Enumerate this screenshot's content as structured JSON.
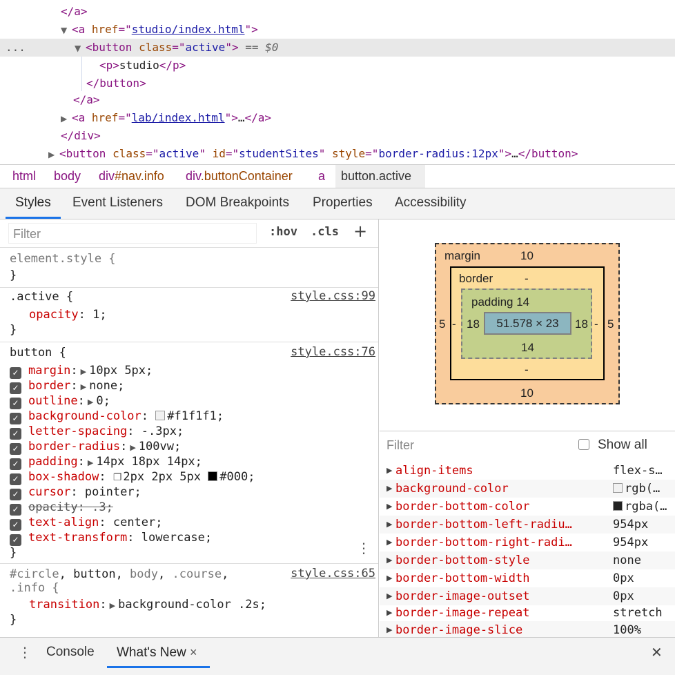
{
  "dom_tree": {
    "lines": [
      {
        "close_a": "</a>"
      },
      {
        "open": "<a",
        "attr": "href",
        "val": "studio/index.html",
        "end": ">"
      },
      {
        "indicator": "...",
        "open": "<button",
        "attr": "class",
        "val": "active",
        "end": ">",
        "eq": " == $0"
      },
      {
        "text": "studio"
      },
      {
        "close_button": "</button>"
      },
      {
        "close_a": "</a>"
      },
      {
        "open": "<a",
        "attr": "href",
        "val": "lab/index.html",
        "end": ">",
        "ellipsis": "…",
        "close": "</a>"
      },
      {
        "close_div": "</div>"
      },
      {
        "open": "<button",
        "attr1": "class",
        "val1": "active",
        "attr2": "id",
        "val2": "studentSites",
        "attr3": "style",
        "val3": "border-radius:12px",
        "end": ">",
        "ellipsis": "…",
        "close": "</button>"
      }
    ],
    "p_open": "<p>",
    "p_close": "</p>"
  },
  "breadcrumb": [
    "html",
    "body",
    "div",
    "#nav.info",
    "div",
    ".buttonContainer",
    "a",
    "button.active"
  ],
  "tabs": [
    "Styles",
    "Event Listeners",
    "DOM Breakpoints",
    "Properties",
    "Accessibility"
  ],
  "styles": {
    "filter_placeholder": "Filter",
    "hov": ":hov",
    "cls": ".cls",
    "plus": "+",
    "element_style": "element.style {",
    "close_brace": "}",
    "active_rule": {
      "selector": ".active {",
      "source": "style.css:99",
      "prop": "opacity",
      "value": "1;"
    },
    "button_rule": {
      "selector": "button {",
      "source": "style.css:76",
      "props": [
        {
          "name": "margin",
          "value": "10px 5px;",
          "expand": true
        },
        {
          "name": "border",
          "value": "none;",
          "expand": true
        },
        {
          "name": "outline",
          "value": "0;",
          "expand": true
        },
        {
          "name": "background-color",
          "value": "#f1f1f1;",
          "swatch": "#f1f1f1"
        },
        {
          "name": "letter-spacing",
          "value": "-.3px;"
        },
        {
          "name": "border-radius",
          "value": "100vw;",
          "expand": true
        },
        {
          "name": "padding",
          "value": "14px 18px 14px;",
          "expand": true
        },
        {
          "name": "box-shadow",
          "value": "2px 2px 5px",
          "value2": "#000;",
          "swatch": "#000000"
        },
        {
          "name": "cursor",
          "value": "pointer;"
        },
        {
          "name": "opacity",
          "value": ".3;",
          "struck": true
        },
        {
          "name": "text-align",
          "value": "center;"
        },
        {
          "name": "text-transform",
          "value": "lowercase;"
        }
      ]
    },
    "transition_rule": {
      "selector1": "#circle",
      "selector2": "button",
      "selector3": "body",
      "selector4": ".course",
      "selector5": ".info {",
      "source": "style.css:65",
      "prop": "transition",
      "value": "background-color .2s;"
    }
  },
  "box_model": {
    "margin_label": "margin",
    "margin_top": "10",
    "margin_bottom": "10",
    "margin_left": "5",
    "margin_right": "5",
    "border_label": "border",
    "border_top": "-",
    "border_bottom": "-",
    "border_left": "-",
    "border_right": "-",
    "padding_label": "padding 14",
    "padding_bottom": "14",
    "padding_left": "18",
    "padding_right": "18",
    "content": "51.578 × 23"
  },
  "computed": {
    "filter_placeholder": "Filter",
    "show_all": "Show all",
    "props": [
      {
        "name": "align-items",
        "value": "flex-s…"
      },
      {
        "name": "background-color",
        "value": "rgb(…",
        "swatch": "#f1f1f1"
      },
      {
        "name": "border-bottom-color",
        "value": "rgba(…",
        "swatch": "#000000"
      },
      {
        "name": "border-bottom-left-radiu…",
        "value": "954px"
      },
      {
        "name": "border-bottom-right-radi…",
        "value": "954px"
      },
      {
        "name": "border-bottom-style",
        "value": "none"
      },
      {
        "name": "border-bottom-width",
        "value": "0px"
      },
      {
        "name": "border-image-outset",
        "value": "0px"
      },
      {
        "name": "border-image-repeat",
        "value": "stretch"
      },
      {
        "name": "border-image-slice",
        "value": "100%"
      }
    ]
  },
  "drawer": {
    "tabs": [
      "Console",
      "What's New"
    ],
    "close_tab": "×",
    "close_drawer": "✕"
  }
}
